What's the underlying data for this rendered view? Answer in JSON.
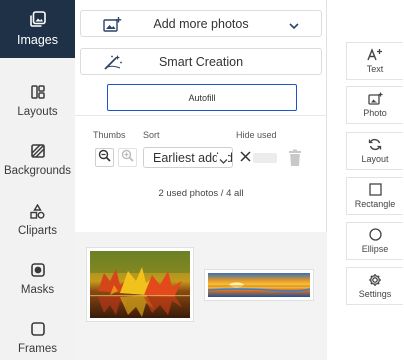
{
  "nav": {
    "items": [
      {
        "label": "Images",
        "icon": "images-icon"
      },
      {
        "label": "Layouts",
        "icon": "layouts-icon"
      },
      {
        "label": "Backgrounds",
        "icon": "backgrounds-icon"
      },
      {
        "label": "Cliparts",
        "icon": "cliparts-icon"
      },
      {
        "label": "Masks",
        "icon": "masks-icon"
      },
      {
        "label": "Frames",
        "icon": "frames-icon"
      }
    ],
    "active": "Images"
  },
  "panel": {
    "add_more_photos": "Add more photos",
    "smart_creation": "Smart Creation",
    "autofill": "Autofill",
    "thumbs_label": "Thumbs",
    "sort_label": "Sort",
    "hide_used_label": "Hide used",
    "sort_value": "Earliest added",
    "used_count": "2 used photos / 4 all"
  },
  "tools": [
    {
      "label": "Text",
      "icon": "text-add-icon"
    },
    {
      "label": "Photo",
      "icon": "photo-add-icon"
    },
    {
      "label": "Layout",
      "icon": "layout-refresh-icon"
    },
    {
      "label": "Rectangle",
      "icon": "rectangle-icon"
    },
    {
      "label": "Ellipse",
      "icon": "ellipse-icon"
    },
    {
      "label": "Settings",
      "icon": "gear-icon"
    }
  ],
  "colors": {
    "active_nav": "#1f3147",
    "nav_bg": "#f2f2f2",
    "autofill_border": "#1a56c8"
  }
}
